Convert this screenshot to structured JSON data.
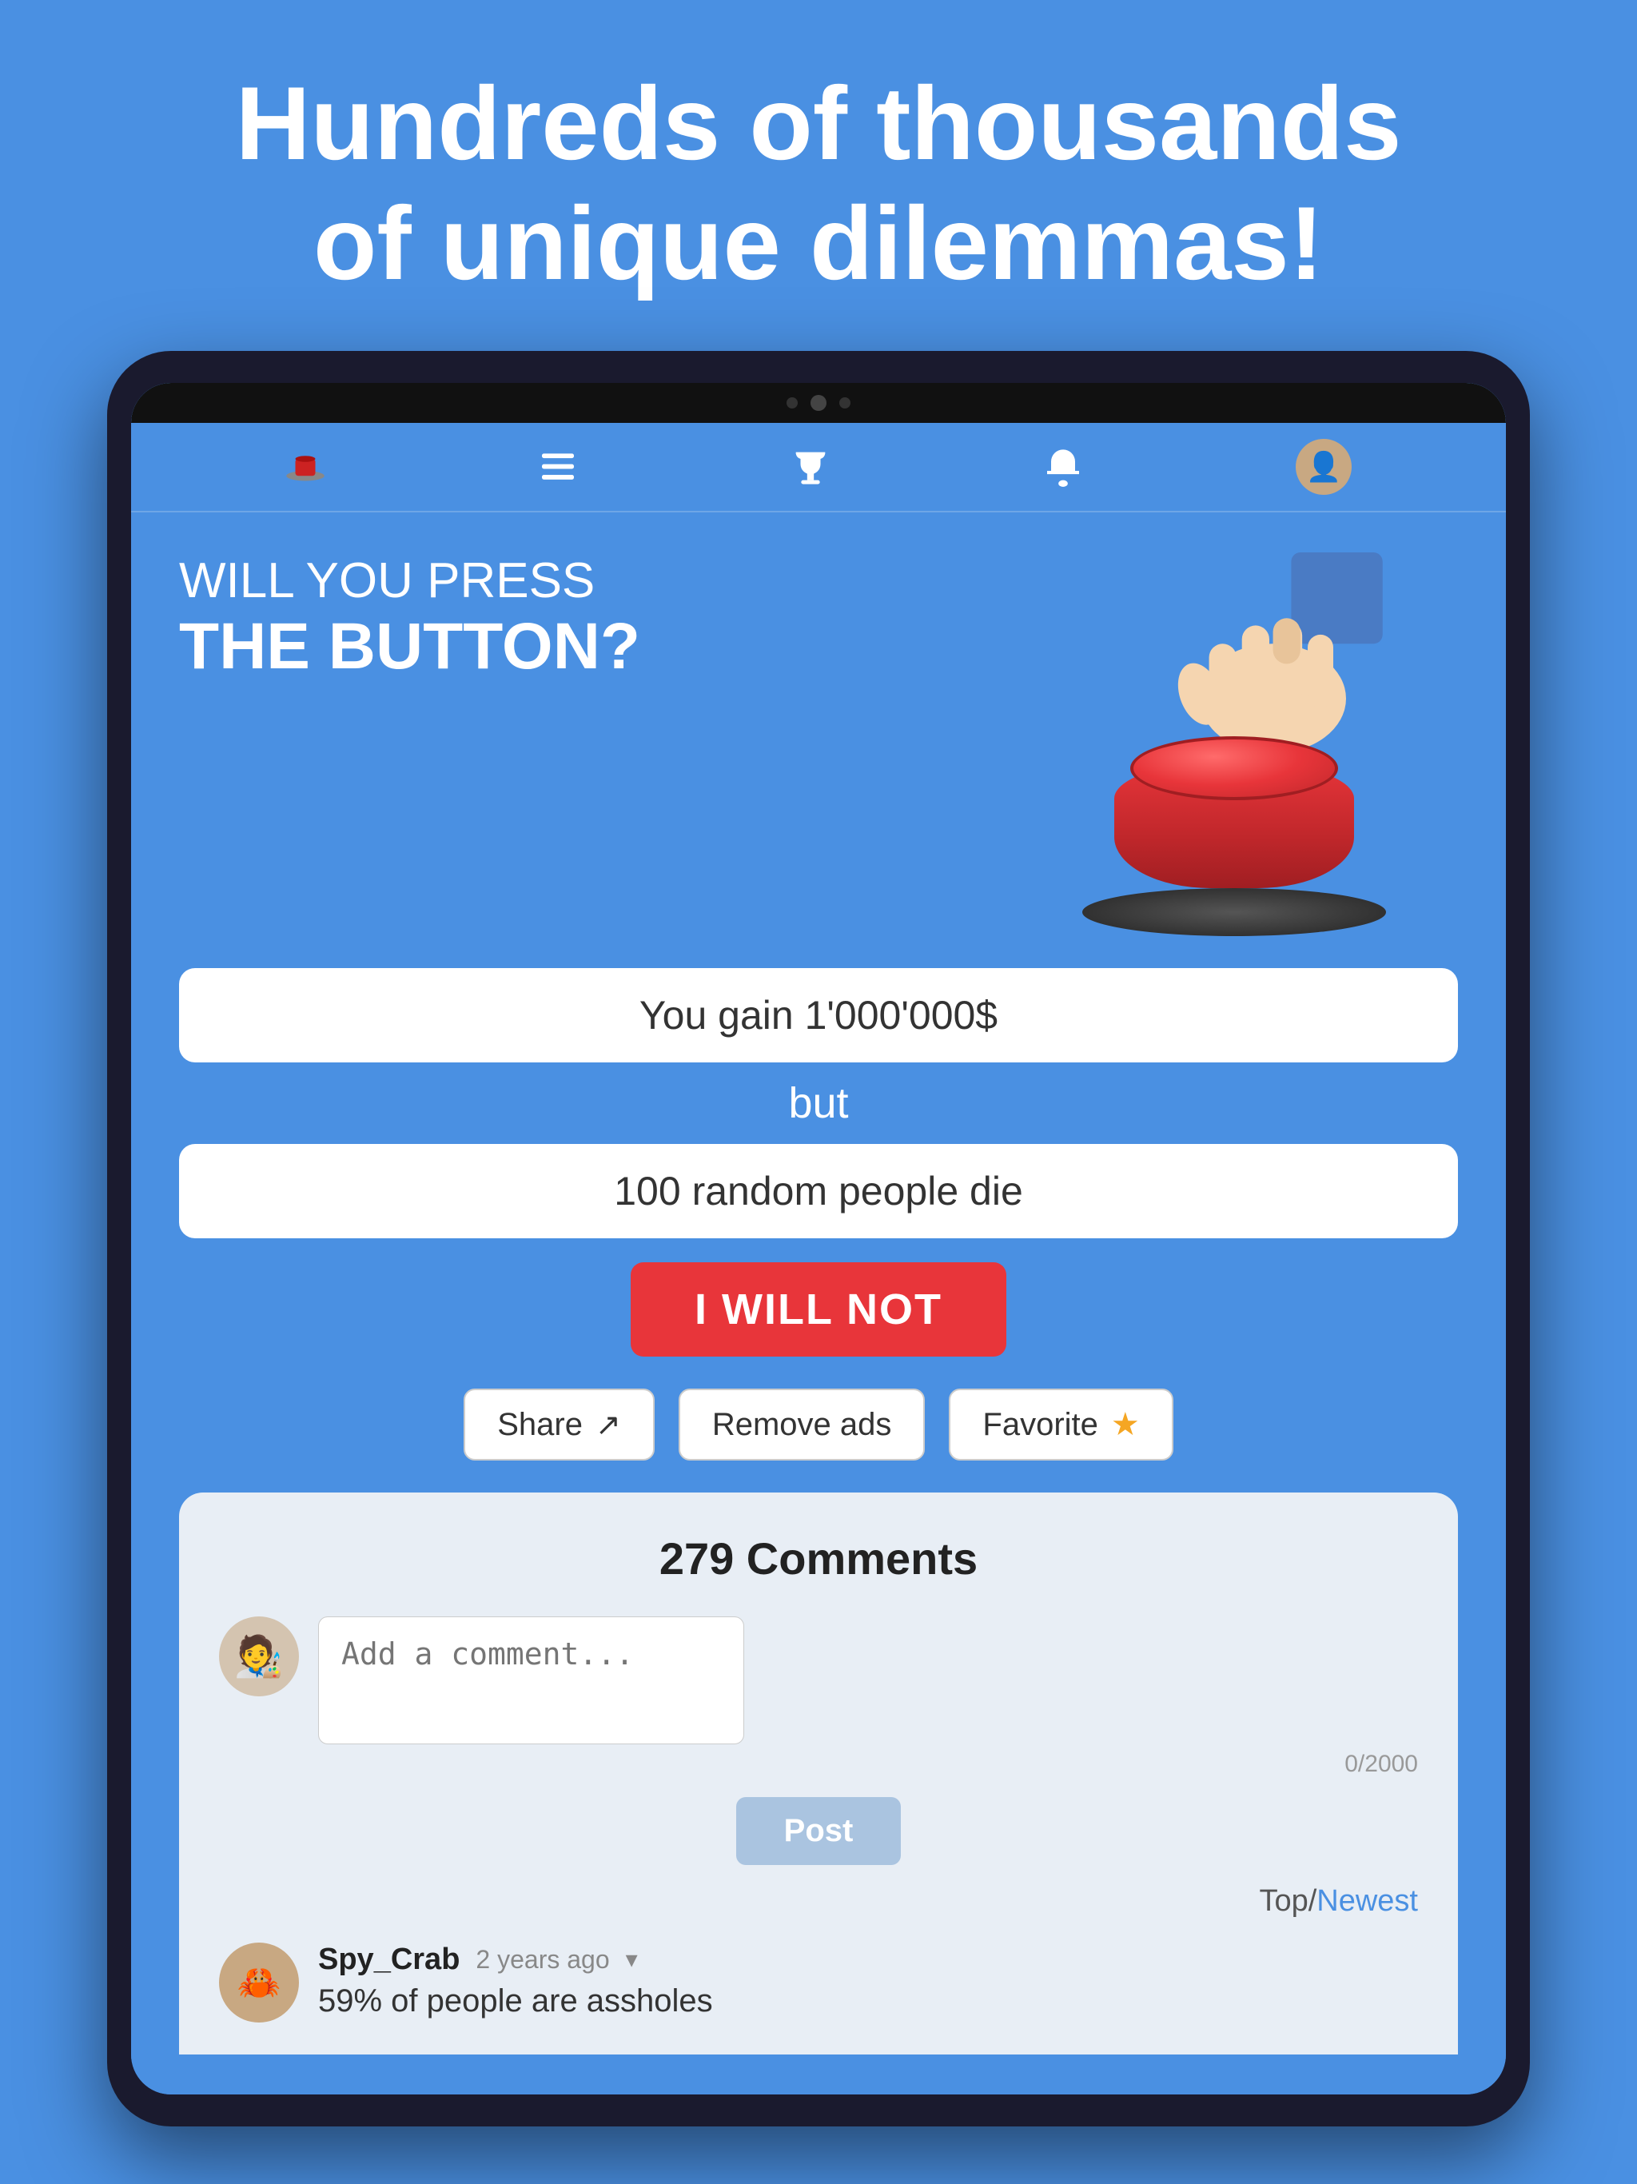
{
  "hero": {
    "title_line1": "Hundreds of thousands",
    "title_line2": "of unique dilemmas!"
  },
  "nav": {
    "items": [
      {
        "id": "hat",
        "label": "Hat icon",
        "active": true
      },
      {
        "id": "list",
        "label": "List icon",
        "active": false
      },
      {
        "id": "trophy",
        "label": "Trophy icon",
        "active": false
      },
      {
        "id": "bell",
        "label": "Bell icon",
        "active": false
      },
      {
        "id": "profile",
        "label": "Profile icon",
        "active": false
      }
    ]
  },
  "question": {
    "will_you_press": "WILL YOU PRESS",
    "the_button": "THE BUTTON?"
  },
  "dilemma": {
    "condition_good": "You gain 1'000'000$",
    "but": "but",
    "condition_bad": "100 random people die"
  },
  "buttons": {
    "i_will_not": "I WILL NOT",
    "share": "Share",
    "remove_ads": "Remove ads",
    "favorite": "Favorite"
  },
  "comments": {
    "title": "279 Comments",
    "input_placeholder": "Add a comment...",
    "char_count": "0/2000",
    "post_button": "Post",
    "sort_label": "Top/",
    "sort_active": "Newest",
    "items": [
      {
        "author": "Spy_Crab",
        "time": "2 years ago",
        "text": "59% of people are assholes",
        "avatar_bg": "#c8a882"
      }
    ]
  }
}
